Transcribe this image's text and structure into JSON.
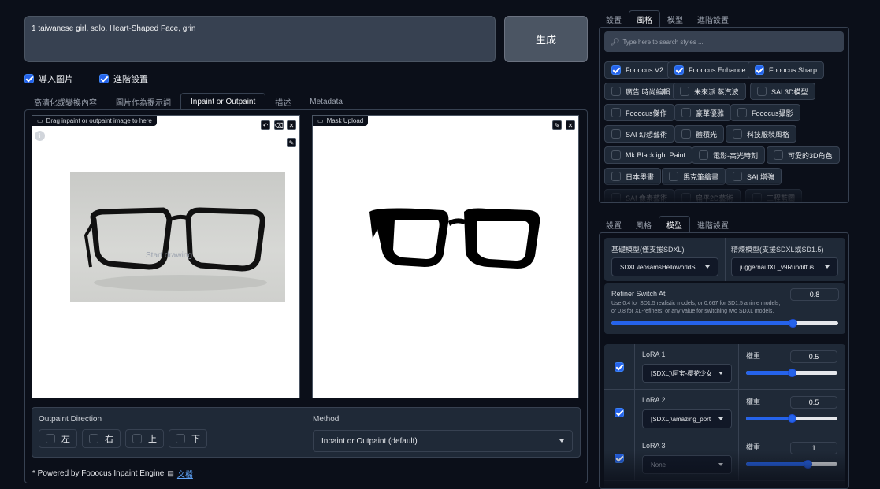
{
  "prompt": {
    "value": "1 taiwanese girl, solo, Heart-Shaped Face, grin"
  },
  "generate_label": "生成",
  "options": {
    "input_image": "導入圖片",
    "advanced": "進階設置"
  },
  "left_tabs": [
    "高清化或變換內容",
    "圖片作為提示詞",
    "Inpaint or Outpaint",
    "描述",
    "Metadata"
  ],
  "inpaint": {
    "drag_label": "Drag inpaint or outpaint image to here",
    "start_drawing": "Start drawing",
    "mask_label": "Mask Upload"
  },
  "outpaint": {
    "title": "Outpaint Direction",
    "directions": [
      "左",
      "右",
      "上",
      "下"
    ],
    "method_title": "Method",
    "method_value": "Inpaint or Outpaint (default)"
  },
  "footer": {
    "text": "* Powered by Fooocus Inpaint Engine",
    "link": "文檔"
  },
  "right_tabs_top": [
    "設置",
    "風格",
    "模型",
    "進階設置"
  ],
  "styles": {
    "search_placeholder": "Type here to search styles ...",
    "items": [
      {
        "label": "Fooocus V2",
        "checked": true
      },
      {
        "label": "Fooocus Enhance",
        "checked": true
      },
      {
        "label": "Fooocus Sharp",
        "checked": true
      },
      {
        "label": "廣告 時尚編輯",
        "checked": false
      },
      {
        "label": "未來派 蒸汽波",
        "checked": false
      },
      {
        "label": "SAI 3D模型",
        "checked": false
      },
      {
        "label": "Fooocus傑作",
        "checked": false
      },
      {
        "label": "豪華優雅",
        "checked": false
      },
      {
        "label": "Fooocus攝影",
        "checked": false
      },
      {
        "label": "SAI 幻想藝術",
        "checked": false
      },
      {
        "label": "體積光",
        "checked": false
      },
      {
        "label": "科技服裝風格",
        "checked": false
      },
      {
        "label": "Mk Blacklight Paint",
        "checked": false
      },
      {
        "label": "電影-高光時刻",
        "checked": false
      },
      {
        "label": "可愛的3D角色",
        "checked": false
      },
      {
        "label": "日本墨畫",
        "checked": false
      },
      {
        "label": "馬克筆繪畫",
        "checked": false
      },
      {
        "label": "SAI 增強",
        "checked": false
      },
      {
        "label": "SAI 像素藝術",
        "checked": false
      },
      {
        "label": "扁平2D藝術",
        "checked": false
      },
      {
        "label": "工程藍圖",
        "checked": false
      }
    ]
  },
  "right_tabs_bottom": [
    "設置",
    "風格",
    "模型",
    "進階設置"
  ],
  "models": {
    "base_label": "基礎模型(僅支援SDXL)",
    "base_value": "SDXL\\leosamsHelloworldS",
    "refiner_label": "精煉模型(支援SDXL或SD1.5)",
    "refiner_value": "juggernautXL_v9Rundiffus",
    "switch_label": "Refiner Switch At",
    "switch_value": "0.8",
    "switch_level": 0.8,
    "switch_help": "Use 0.4 for SD1.5 realistic models; or 0.667 for SD1.5 anime models; or 0.8 for XL-refiners; or any value for switching two SDXL models."
  },
  "loras": [
    {
      "label": "LoRA 1",
      "value": "[SDXL]\\阿宝-櫻花少女",
      "weight_label": "權重",
      "weight": "0.5",
      "level": 0.5,
      "checked": true
    },
    {
      "label": "LoRA 2",
      "value": "[SDXL]\\amazing_port",
      "weight_label": "權重",
      "weight": "0.5",
      "level": 0.5,
      "checked": true
    },
    {
      "label": "LoRA 3",
      "value": "None",
      "weight_label": "權重",
      "weight": "1",
      "level": 0.67,
      "checked": true
    }
  ],
  "colors": {
    "accent": "#2563eb",
    "background": "#0b0f19",
    "panel": "#1f2937"
  }
}
